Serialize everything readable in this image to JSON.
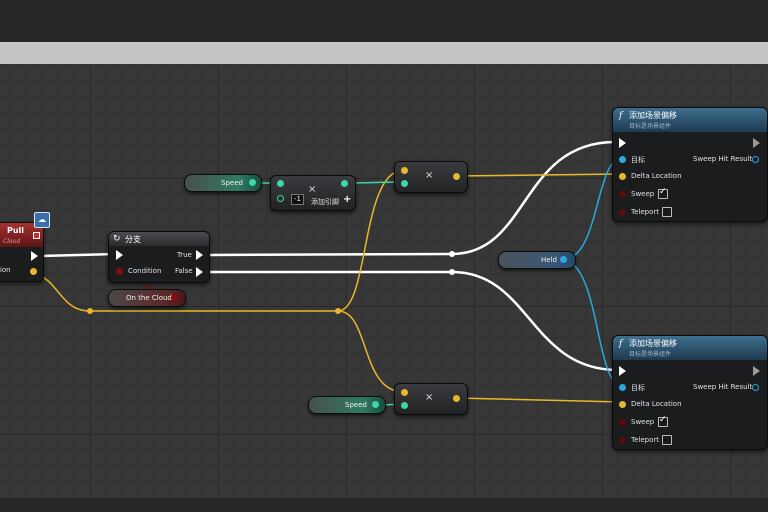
{
  "colors": {
    "exec": "#ffffff",
    "vector": "#f5c518",
    "float": "#3cd6a8",
    "bool": "#8a0d0d",
    "object": "#2aa8e0"
  },
  "event_node": {
    "title": "Pull",
    "subtitle": "Cloud",
    "pin_location": "Location",
    "icon": "cloud-badge-icon"
  },
  "branch_node": {
    "title": "分支",
    "pin_condition": "Condition",
    "pin_true": "True",
    "pin_false": "False",
    "icon": "branch-icon"
  },
  "on_the_cloud": {
    "label": "On the Cloud"
  },
  "speed_top": {
    "label": "Speed"
  },
  "speed_bottom": {
    "label": "Speed"
  },
  "multiply_node": {
    "value": "-1",
    "add_pin": "添加引脚",
    "symbol": "×",
    "plus": "+"
  },
  "mult_top": {
    "symbol": "×"
  },
  "mult_bottom": {
    "symbol": "×"
  },
  "held": {
    "label": "Held"
  },
  "offset_top": {
    "title": "添加场景偏移",
    "subtitle": "目标是场景组件",
    "pin_target": "目标",
    "pin_delta": "Delta Location",
    "pin_sweep": "Sweep",
    "pin_teleport": "Teleport",
    "pin_result": "Sweep Hit Result",
    "sweep_checked": true,
    "teleport_checked": false
  },
  "offset_bottom": {
    "title": "添加场景偏移",
    "subtitle": "目标是场景组件",
    "pin_target": "目标",
    "pin_delta": "Delta Location",
    "pin_sweep": "Sweep",
    "pin_teleport": "Teleport",
    "pin_result": "Sweep Hit Result",
    "sweep_checked": true,
    "teleport_checked": false
  }
}
